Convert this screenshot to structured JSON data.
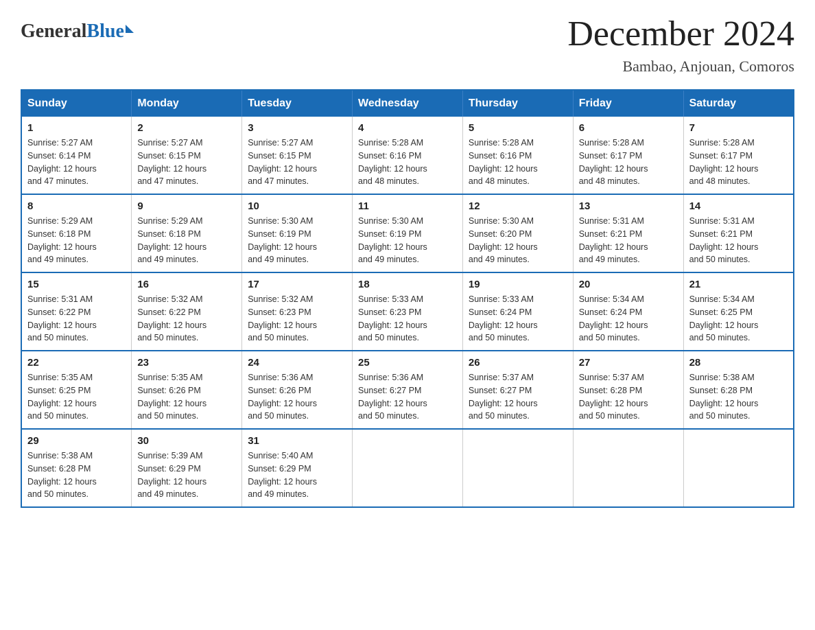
{
  "logo": {
    "general": "General",
    "blue": "Blue",
    "triangle": "▶"
  },
  "title": "December 2024",
  "subtitle": "Bambao, Anjouan, Comoros",
  "weekdays": [
    "Sunday",
    "Monday",
    "Tuesday",
    "Wednesday",
    "Thursday",
    "Friday",
    "Saturday"
  ],
  "weeks": [
    [
      {
        "day": "1",
        "sunrise": "5:27 AM",
        "sunset": "6:14 PM",
        "daylight": "12 hours and 47 minutes."
      },
      {
        "day": "2",
        "sunrise": "5:27 AM",
        "sunset": "6:15 PM",
        "daylight": "12 hours and 47 minutes."
      },
      {
        "day": "3",
        "sunrise": "5:27 AM",
        "sunset": "6:15 PM",
        "daylight": "12 hours and 47 minutes."
      },
      {
        "day": "4",
        "sunrise": "5:28 AM",
        "sunset": "6:16 PM",
        "daylight": "12 hours and 48 minutes."
      },
      {
        "day": "5",
        "sunrise": "5:28 AM",
        "sunset": "6:16 PM",
        "daylight": "12 hours and 48 minutes."
      },
      {
        "day": "6",
        "sunrise": "5:28 AM",
        "sunset": "6:17 PM",
        "daylight": "12 hours and 48 minutes."
      },
      {
        "day": "7",
        "sunrise": "5:28 AM",
        "sunset": "6:17 PM",
        "daylight": "12 hours and 48 minutes."
      }
    ],
    [
      {
        "day": "8",
        "sunrise": "5:29 AM",
        "sunset": "6:18 PM",
        "daylight": "12 hours and 49 minutes."
      },
      {
        "day": "9",
        "sunrise": "5:29 AM",
        "sunset": "6:18 PM",
        "daylight": "12 hours and 49 minutes."
      },
      {
        "day": "10",
        "sunrise": "5:30 AM",
        "sunset": "6:19 PM",
        "daylight": "12 hours and 49 minutes."
      },
      {
        "day": "11",
        "sunrise": "5:30 AM",
        "sunset": "6:19 PM",
        "daylight": "12 hours and 49 minutes."
      },
      {
        "day": "12",
        "sunrise": "5:30 AM",
        "sunset": "6:20 PM",
        "daylight": "12 hours and 49 minutes."
      },
      {
        "day": "13",
        "sunrise": "5:31 AM",
        "sunset": "6:21 PM",
        "daylight": "12 hours and 49 minutes."
      },
      {
        "day": "14",
        "sunrise": "5:31 AM",
        "sunset": "6:21 PM",
        "daylight": "12 hours and 50 minutes."
      }
    ],
    [
      {
        "day": "15",
        "sunrise": "5:31 AM",
        "sunset": "6:22 PM",
        "daylight": "12 hours and 50 minutes."
      },
      {
        "day": "16",
        "sunrise": "5:32 AM",
        "sunset": "6:22 PM",
        "daylight": "12 hours and 50 minutes."
      },
      {
        "day": "17",
        "sunrise": "5:32 AM",
        "sunset": "6:23 PM",
        "daylight": "12 hours and 50 minutes."
      },
      {
        "day": "18",
        "sunrise": "5:33 AM",
        "sunset": "6:23 PM",
        "daylight": "12 hours and 50 minutes."
      },
      {
        "day": "19",
        "sunrise": "5:33 AM",
        "sunset": "6:24 PM",
        "daylight": "12 hours and 50 minutes."
      },
      {
        "day": "20",
        "sunrise": "5:34 AM",
        "sunset": "6:24 PM",
        "daylight": "12 hours and 50 minutes."
      },
      {
        "day": "21",
        "sunrise": "5:34 AM",
        "sunset": "6:25 PM",
        "daylight": "12 hours and 50 minutes."
      }
    ],
    [
      {
        "day": "22",
        "sunrise": "5:35 AM",
        "sunset": "6:25 PM",
        "daylight": "12 hours and 50 minutes."
      },
      {
        "day": "23",
        "sunrise": "5:35 AM",
        "sunset": "6:26 PM",
        "daylight": "12 hours and 50 minutes."
      },
      {
        "day": "24",
        "sunrise": "5:36 AM",
        "sunset": "6:26 PM",
        "daylight": "12 hours and 50 minutes."
      },
      {
        "day": "25",
        "sunrise": "5:36 AM",
        "sunset": "6:27 PM",
        "daylight": "12 hours and 50 minutes."
      },
      {
        "day": "26",
        "sunrise": "5:37 AM",
        "sunset": "6:27 PM",
        "daylight": "12 hours and 50 minutes."
      },
      {
        "day": "27",
        "sunrise": "5:37 AM",
        "sunset": "6:28 PM",
        "daylight": "12 hours and 50 minutes."
      },
      {
        "day": "28",
        "sunrise": "5:38 AM",
        "sunset": "6:28 PM",
        "daylight": "12 hours and 50 minutes."
      }
    ],
    [
      {
        "day": "29",
        "sunrise": "5:38 AM",
        "sunset": "6:28 PM",
        "daylight": "12 hours and 50 minutes."
      },
      {
        "day": "30",
        "sunrise": "5:39 AM",
        "sunset": "6:29 PM",
        "daylight": "12 hours and 49 minutes."
      },
      {
        "day": "31",
        "sunrise": "5:40 AM",
        "sunset": "6:29 PM",
        "daylight": "12 hours and 49 minutes."
      },
      null,
      null,
      null,
      null
    ]
  ],
  "labels": {
    "sunrise": "Sunrise:",
    "sunset": "Sunset:",
    "daylight": "Daylight:"
  }
}
